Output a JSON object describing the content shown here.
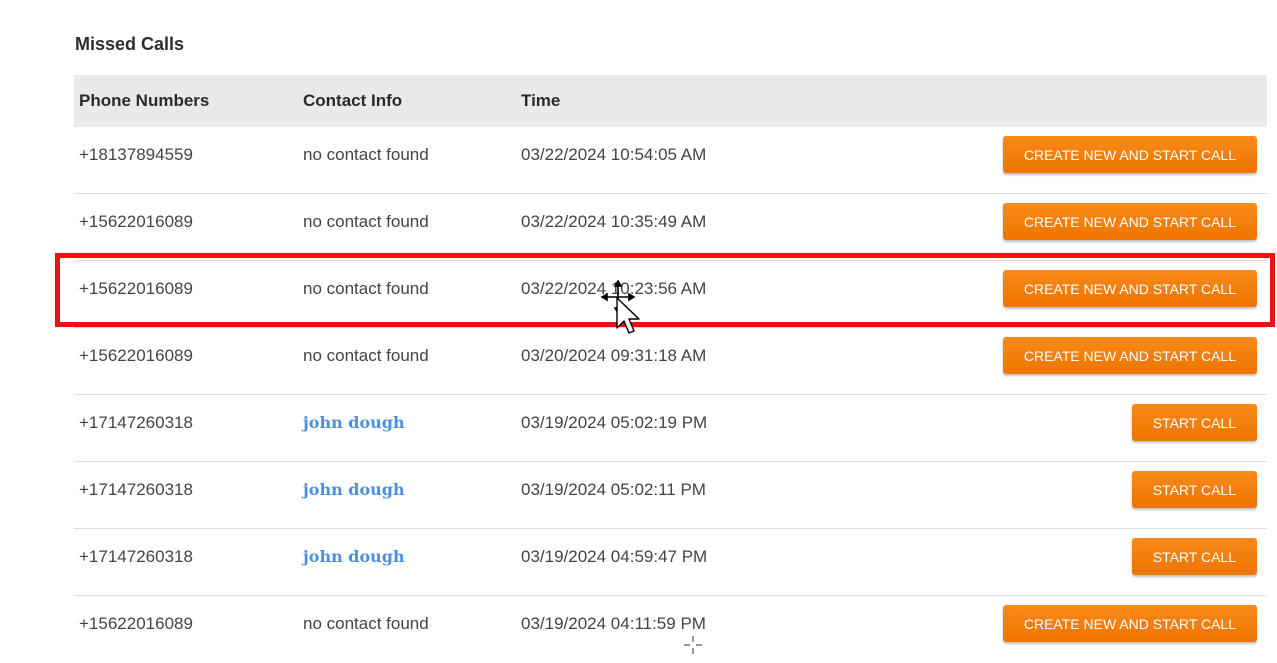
{
  "section": {
    "title": "Missed Calls"
  },
  "table": {
    "headers": {
      "phone": "Phone Numbers",
      "contact": "Contact Info",
      "time": "Time"
    },
    "rows": [
      {
        "phone": "+18137894559",
        "contact": "no contact found",
        "time": "03/22/2024 10:54:05 AM",
        "action": "CREATE NEW AND START CALL"
      },
      {
        "phone": "+15622016089",
        "contact": "no contact found",
        "time": "03/22/2024 10:35:49 AM",
        "action": "CREATE NEW AND START CALL"
      },
      {
        "phone": "+15622016089",
        "contact": "no contact found",
        "time": "03/22/2024 10:23:56 AM",
        "action": "CREATE NEW AND START CALL"
      },
      {
        "phone": "+15622016089",
        "contact": "no contact found",
        "time": "03/20/2024 09:31:18 AM",
        "action": "CREATE NEW AND START CALL"
      },
      {
        "phone": "+17147260318",
        "contact": "john dough",
        "time": "03/19/2024 05:02:19 PM",
        "action": "START CALL"
      },
      {
        "phone": "+17147260318",
        "contact": "john dough",
        "time": "03/19/2024 05:02:11 PM",
        "action": "START CALL"
      },
      {
        "phone": "+17147260318",
        "contact": "john dough",
        "time": "03/19/2024 04:59:47 PM",
        "action": "START CALL"
      },
      {
        "phone": "+15622016089",
        "contact": "no contact found",
        "time": "03/19/2024 04:11:59 PM",
        "action": "CREATE NEW AND START CALL"
      }
    ]
  },
  "colors": {
    "accent": "#f07a05",
    "link": "#4a8fe0",
    "highlight": "#ee1111",
    "header_bg": "#eaeaec"
  },
  "icons": {
    "cursor": "arrow-cursor-with-move-icon",
    "crosshair": "crosshair-icon"
  }
}
